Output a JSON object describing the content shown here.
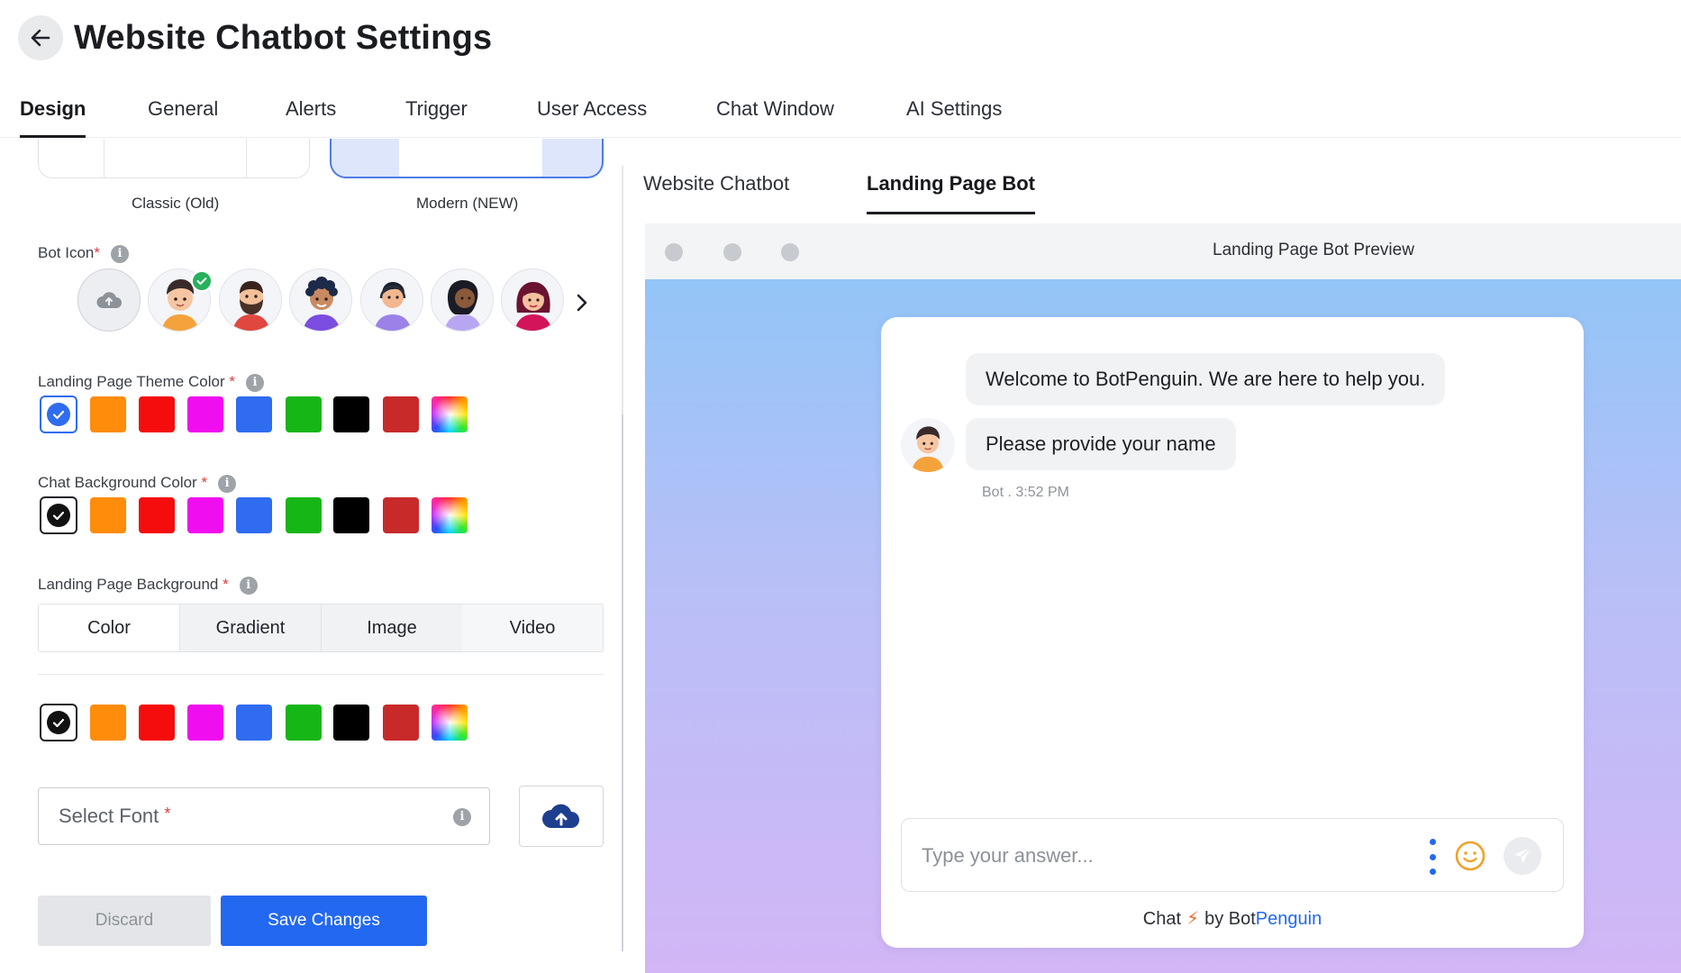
{
  "header": {
    "title": "Website Chatbot Settings"
  },
  "main_tabs": [
    {
      "label": "Design",
      "active": true
    },
    {
      "label": "General",
      "active": false
    },
    {
      "label": "Alerts",
      "active": false
    },
    {
      "label": "Trigger",
      "active": false
    },
    {
      "label": "User Access",
      "active": false
    },
    {
      "label": "Chat Window",
      "active": false
    },
    {
      "label": "AI Settings",
      "active": false
    }
  ],
  "layout": {
    "classic_label": "Classic (Old)",
    "modern_label": "Modern (NEW)",
    "selected": "Modern (NEW)"
  },
  "bot_icon": {
    "label": "Bot Icon",
    "required_mark": "*",
    "info_icon": "i",
    "upload_icon": "cloud-upload-icon",
    "selected_index": 0
  },
  "theme_color": {
    "label": "Landing Page Theme Color",
    "required_mark": "*",
    "info_icon": "i",
    "selected": "#2f6cf0"
  },
  "chat_bg_color": {
    "label": "Chat Background Color",
    "required_mark": "*",
    "info_icon": "i",
    "selected": "#ffffff"
  },
  "landing_bg": {
    "label": "Landing Page Background",
    "required_mark": "*",
    "info_icon": "i",
    "tabs": [
      "Color",
      "Gradient",
      "Image",
      "Video"
    ],
    "active_tab": "Color",
    "selected": "#ffffff"
  },
  "swatch_colors": [
    "#ff8c0a",
    "#f50c0c",
    "#f00ef0",
    "#2f6cf0",
    "#17b617",
    "#000000",
    "#c82a2a"
  ],
  "font": {
    "placeholder": "Select Font",
    "required_mark": "*",
    "info_icon": "i"
  },
  "buttons": {
    "discard": "Discard",
    "save": "Save Changes"
  },
  "preview_tabs": [
    {
      "label": "Website Chatbot",
      "active": false
    },
    {
      "label": "Landing Page Bot",
      "active": true
    }
  ],
  "preview": {
    "window_title": "Landing Page Bot Preview",
    "messages": [
      {
        "text": "Welcome to BotPenguin. We are here to help you."
      },
      {
        "text": "Please provide your name"
      }
    ],
    "timestamp": "Bot . 3:52 PM",
    "input_placeholder": "Type your answer...",
    "powered_chat": "Chat",
    "powered_by": "by Bot",
    "powered_brand": "Penguin"
  },
  "colors": {
    "accent": "#2368f0",
    "success": "#27b05d"
  }
}
